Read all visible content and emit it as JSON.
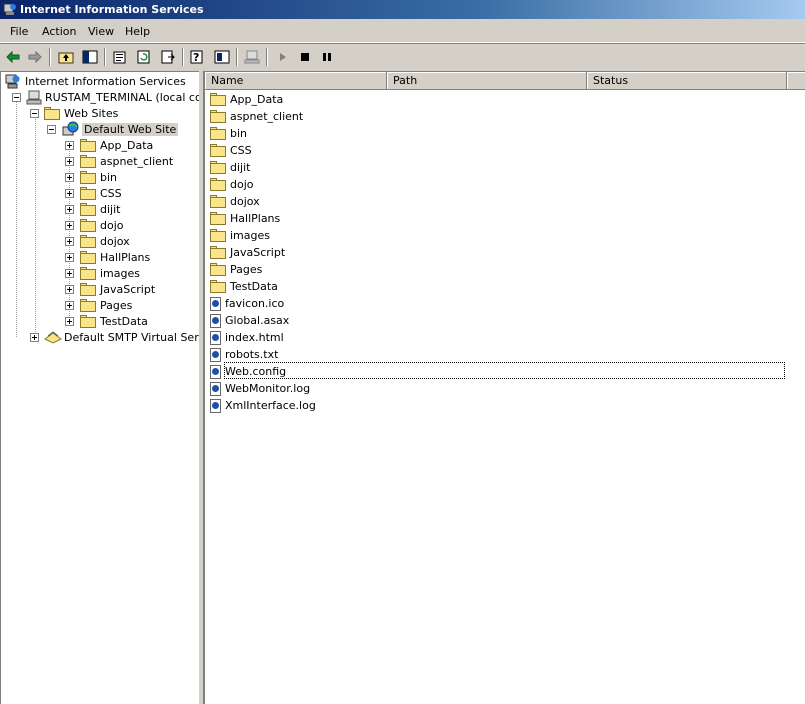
{
  "window": {
    "title": "Internet Information Services"
  },
  "menu": [
    "File",
    "Action",
    "View",
    "Help"
  ],
  "toolbar": {
    "buttons": [
      "back-icon",
      "forward-icon",
      "up-folder-icon",
      "show-tree-icon",
      "properties-icon",
      "refresh-icon",
      "export-icon",
      "help-icon",
      "console-icon",
      "computer-icon",
      "play-icon",
      "stop-icon",
      "pause-icon"
    ]
  },
  "tree": {
    "root": "Internet Information Services",
    "server": "RUSTAM_TERMINAL (local comp",
    "web_sites": "Web Sites",
    "default_site": "Default Web Site",
    "children": [
      "App_Data",
      "aspnet_client",
      "bin",
      "CSS",
      "dijit",
      "dojo",
      "dojox",
      "HallPlans",
      "images",
      "JavaScript",
      "Pages",
      "TestData"
    ],
    "smtp": "Default SMTP Virtual Server"
  },
  "list": {
    "columns": [
      "Name",
      "Path",
      "Status"
    ],
    "folders": [
      "App_Data",
      "aspnet_client",
      "bin",
      "CSS",
      "dijit",
      "dojo",
      "dojox",
      "HallPlans",
      "images",
      "JavaScript",
      "Pages",
      "TestData"
    ],
    "files": [
      "favicon.ico",
      "Global.asax",
      "index.html",
      "robots.txt",
      "Web.config",
      "WebMonitor.log",
      "XmlInterface.log"
    ],
    "selected": "Web.config"
  },
  "colors": {
    "title_start": "#0a246a",
    "title_end": "#a6caf0",
    "chrome": "#d4d0c8",
    "selection": "#d4d0c8"
  }
}
